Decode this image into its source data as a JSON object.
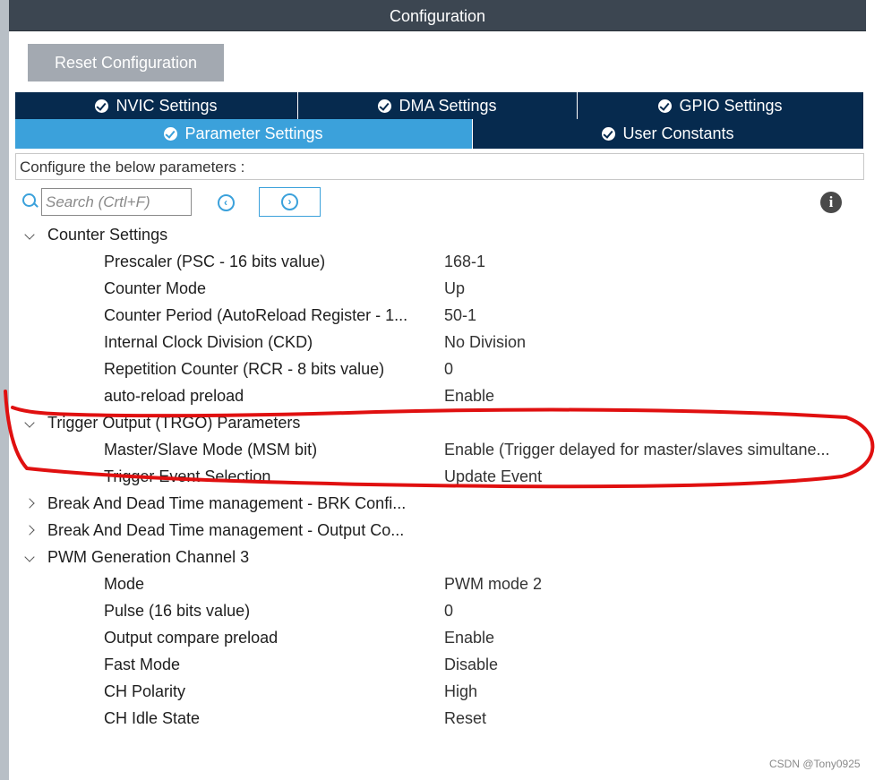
{
  "window": {
    "title": "Configuration"
  },
  "toolbar": {
    "reset_label": "Reset Configuration"
  },
  "tabs": {
    "row1": [
      {
        "label": "NVIC Settings",
        "active": false
      },
      {
        "label": "DMA Settings",
        "active": false
      },
      {
        "label": "GPIO Settings",
        "active": false
      }
    ],
    "row2": [
      {
        "label": "Parameter Settings",
        "active": true
      },
      {
        "label": "User Constants",
        "active": false
      }
    ]
  },
  "description": "Configure the below parameters :",
  "search": {
    "placeholder": "Search (Crtl+F)"
  },
  "colors": {
    "tab_bg": "#062a4e",
    "tab_active": "#3ba1db",
    "title_bar": "#3c4651",
    "annotation": "#e01010"
  },
  "tree": {
    "counter": {
      "label": "Counter Settings",
      "params": [
        {
          "name": "Prescaler (PSC - 16 bits value)",
          "value": "168-1"
        },
        {
          "name": "Counter Mode",
          "value": "Up"
        },
        {
          "name": "Counter Period (AutoReload Register - 1...",
          "value": "50-1"
        },
        {
          "name": "Internal Clock Division (CKD)",
          "value": "No Division"
        },
        {
          "name": "Repetition Counter (RCR - 8 bits value)",
          "value": "0"
        },
        {
          "name": "auto-reload preload",
          "value": "Enable"
        }
      ]
    },
    "trgo": {
      "label": "Trigger Output (TRGO) Parameters",
      "params": [
        {
          "name": "Master/Slave Mode (MSM bit)",
          "value": "Enable (Trigger delayed for master/slaves simultane..."
        },
        {
          "name": "Trigger Event Selection",
          "value": "Update Event"
        }
      ]
    },
    "brk": {
      "label": "Break And Dead Time management - BRK Confi..."
    },
    "output": {
      "label": "Break And Dead Time management - Output Co..."
    },
    "pwm": {
      "label": "PWM Generation Channel 3",
      "params": [
        {
          "name": "Mode",
          "value": "PWM mode 2"
        },
        {
          "name": "Pulse (16 bits value)",
          "value": "0"
        },
        {
          "name": "Output compare preload",
          "value": "Enable"
        },
        {
          "name": "Fast Mode",
          "value": "Disable"
        },
        {
          "name": "CH Polarity",
          "value": "High"
        },
        {
          "name": "CH Idle State",
          "value": "Reset"
        }
      ]
    }
  },
  "watermark": "CSDN @Tony0925"
}
